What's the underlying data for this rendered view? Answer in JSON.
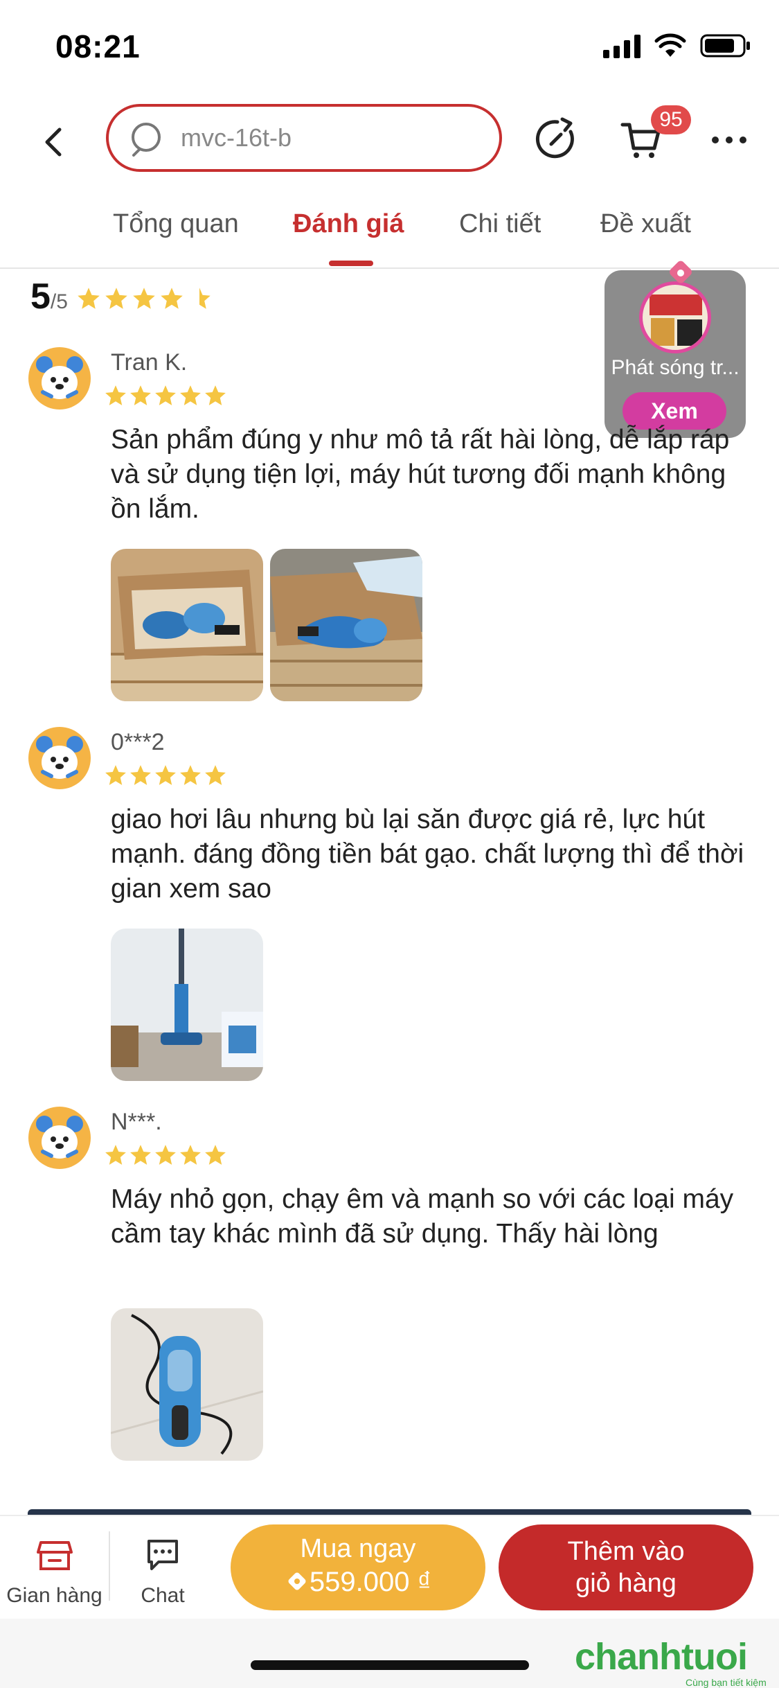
{
  "status_bar": {
    "time": "08:21"
  },
  "header": {
    "search_text": "mvc-16t-b",
    "cart_count": "95"
  },
  "tabs": [
    {
      "label": "Tổng quan"
    },
    {
      "label": "Đánh giá"
    },
    {
      "label": "Chi tiết"
    },
    {
      "label": "Đề xuất"
    }
  ],
  "rating": {
    "score": "5",
    "max": "/5",
    "stars": 4.5
  },
  "live": {
    "title": "Phát sóng tr...",
    "button": "Xem"
  },
  "reviews": [
    {
      "name": "Tran K.",
      "stars": 5,
      "text": "Sản phẩm đúng y như mô tả rất hài lòng, dễ lắp ráp và sử dụng tiện lợi, máy hút tương đối mạnh không ồn lắm.",
      "photos": 2
    },
    {
      "name": "0***2",
      "stars": 5,
      "text": "giao hơi lâu nhưng bù lại săn được giá rẻ, lực hút mạnh.  đáng đồng tiền bát gạo. chất lượng thì để thời gian xem sao",
      "photos": 1
    },
    {
      "name": "N***.",
      "stars": 5,
      "text": "Máy nhỏ gọn, chạy êm và mạnh so với các loại máy cầm tay khác mình đã sử dụng. Thấy hài lòng",
      "photos": 1
    }
  ],
  "bottom_bar": {
    "shop_label": "Gian hàng",
    "chat_label": "Chat",
    "buy_label": "Mua ngay",
    "buy_price": "559.000 ₫",
    "add_cart_line1": "Thêm vào",
    "add_cart_line2": "giỏ hàng"
  },
  "watermark": {
    "brand": "chanhtuoi",
    "tagline": "Cùng bạn tiết kiệm"
  },
  "colors": {
    "accent": "#c62f2f",
    "star": "#f5c542",
    "buy": "#f2b23b",
    "live_pink": "#d33ca0"
  }
}
